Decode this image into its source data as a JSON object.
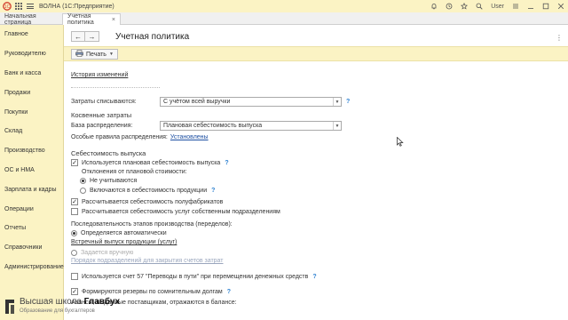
{
  "titlebar": {
    "app_title": "ВОЛНА  (1С:Предприятие)",
    "user": "User"
  },
  "tabs": {
    "home": "Начальная страница",
    "active": "Учетная политика",
    "close": "×"
  },
  "sidebar": {
    "items": [
      {
        "label": "Главное"
      },
      {
        "label": "Руководителю"
      },
      {
        "label": "Банк и касса"
      },
      {
        "label": "Продажи"
      },
      {
        "label": "Покупки"
      },
      {
        "label": "Склад"
      },
      {
        "label": "Производство"
      },
      {
        "label": "ОС и НМА"
      },
      {
        "label": "Зарплата и кадры"
      },
      {
        "label": "Операции"
      },
      {
        "label": "Отчеты"
      },
      {
        "label": "Справочники"
      },
      {
        "label": "Администрирование"
      }
    ]
  },
  "header": {
    "back": "←",
    "forward": "→",
    "title": "Учетная политика",
    "more": "⋮"
  },
  "toolbar": {
    "print_label": "Печать"
  },
  "form": {
    "history_link": "История изменений",
    "costs_written_label": "Затраты списываются:",
    "costs_written_value": "С учётом всей выручки",
    "indirect_heading": "Косвенные затраты",
    "distribution_base_label": "База распределения:",
    "distribution_base_value": "Плановая себестоимость выпуска",
    "special_rules_label": "Особые правила распределения:",
    "special_rules_link": "Установлены",
    "cost_heading": "Себестоимость выпуска",
    "planned_cost_label": "Используется плановая себестоимость выпуска",
    "deviations_label": "Отклонения от плановой стоимости:",
    "not_considered_label": "Не учитываются",
    "included_label": "Включаются в себестоимость продукции",
    "semi_finished_label": "Рассчитывается себестоимость полуфабрикатов",
    "own_services_label": "Рассчитывается себестоимость услуг собственным подразделениям",
    "sequence_label": "Последовательность этапов производства (переделов):",
    "auto_label": "Определяется автоматически",
    "counter_release_link": "Встречный выпуск продукции (услуг)",
    "manual_label": "Задается вручную",
    "order_link": "Порядок подразделений для закрытия счетов затрат",
    "account57_label": "Используется счет 57 \"Переводы в пути\" при перемещении денежных средств",
    "reserves_label": "Формируются резервы по сомнительным долгам",
    "advances_label": "Авансы, выданные поставщикам, отражаются в балансе:",
    "q": "?"
  },
  "watermark": {
    "title_a": "Высшая школа",
    "title_b": "Главбух",
    "subtitle": "Образование для бухгалтеров"
  }
}
